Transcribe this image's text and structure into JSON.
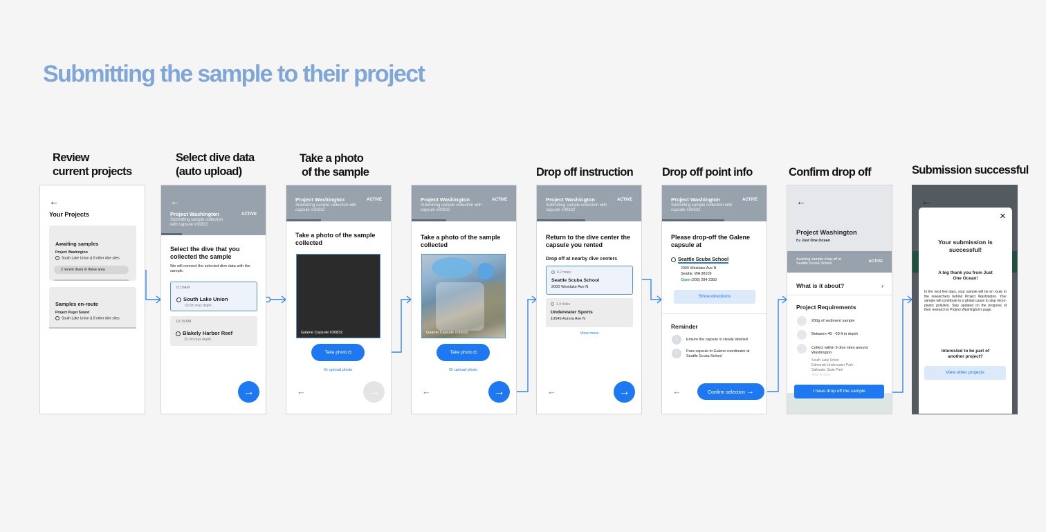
{
  "title": "Submitting the sample to their project",
  "steps": [
    {
      "title": [
        "Review",
        "current projects"
      ]
    },
    {
      "title": [
        "Select dive data",
        "(auto upload)"
      ]
    },
    {
      "title": [
        "Take a photo",
        "of the sample"
      ]
    },
    {
      "title": [
        "",
        ""
      ]
    },
    {
      "title": [
        "Drop off instruction",
        ""
      ]
    },
    {
      "title": [
        "Drop off point info",
        ""
      ]
    },
    {
      "title": [
        "Confirm drop off",
        ""
      ]
    },
    {
      "title": [
        "Submission successful",
        ""
      ]
    }
  ],
  "project": {
    "name": "Project Washington",
    "subtitle": "Submitting sample collection with capsule #30832",
    "status": "ACTIVE"
  },
  "s1": {
    "heading": "Your Projects",
    "card1": {
      "title": "Awaiting samples",
      "project": "Project Washington",
      "location": "South Lake Union & 8 other dive sites",
      "chip": "2 recent dives in these area"
    },
    "card2": {
      "title": "Samples en-route",
      "project": "Project Puget Sound",
      "location": "South Lake Union & 8 other dive sites"
    }
  },
  "s2": {
    "heading": "Select the dive that you collected the sample",
    "desc": "We will connect the selected dive data with the sample.",
    "dives": [
      {
        "time": "8:10AM",
        "site": "South Lake Union",
        "depth": "20.5m max depth"
      },
      {
        "time": "10:15AM",
        "site": "Blakely Harbor Reef",
        "depth": "23.2m max depth"
      }
    ]
  },
  "photo": {
    "heading": "Take a photo of the sample collected",
    "capsule": "Galene Capsule #30832",
    "take": "Take photo",
    "upload": "Or upload photo"
  },
  "s5": {
    "heading": "Return to the dive center the capsule you rented",
    "sub": "Drop off at nearby dive centers",
    "centers": [
      {
        "dist": "0.2 miles",
        "name": "Seattle Scuba School",
        "addr": "2000 Westlake Ave N"
      },
      {
        "dist": "1.4 miles",
        "name": "Underwater Sports",
        "addr": "10545 Aurora Ave N"
      }
    ],
    "more": "View more"
  },
  "s6": {
    "heading": "Please drop-off the Galene capsule at",
    "name": "Seattle Scuba School",
    "addr1": "2000 Westlake Ave N",
    "addr2": "Seattle, WA 98109",
    "open": "Open",
    "phone": "(206) 284-2350",
    "directions": "Show directions",
    "reminder": "Reminder",
    "items": [
      "Ensure the capsule is clearly labelled",
      "Pass capsule to Galene coordinator at Seattle Scuba School"
    ],
    "nums": [
      "1",
      "2"
    ],
    "confirm": "Confirm selection"
  },
  "s7": {
    "by": "By",
    "org": "Just One Ocean",
    "banner": "Awaiting sample drop-off at Seattle Scuba School",
    "about": "What is it about?",
    "req": "Project Requirements",
    "reqs": [
      "200g of sediment sample",
      "Between 40 - 60 ft in depth",
      "Collect within 9 dive sites around Washington"
    ],
    "sites": [
      "South Lake Union",
      "Edmonds Underwater Park",
      "Saltwater State Park",
      "View 6 more"
    ],
    "cta": "I have drop off the sample"
  },
  "s8": {
    "heading": "Your submission is successful!",
    "thanks": "A big thank you from Just One Ocean!",
    "body": "In the next few days, your sample will be en route to the researchers behind Project Washington. Your sample will contribute to a global cause to stop micro-plastic pollution. Stay updated on the progress of their research in Project Washington's page.",
    "q": "Interested to be part of another project?",
    "btn": "View other projects"
  },
  "colors": {
    "accent": "#1d78f2",
    "title": "#7ea7d8",
    "header": "#98a2ac"
  }
}
